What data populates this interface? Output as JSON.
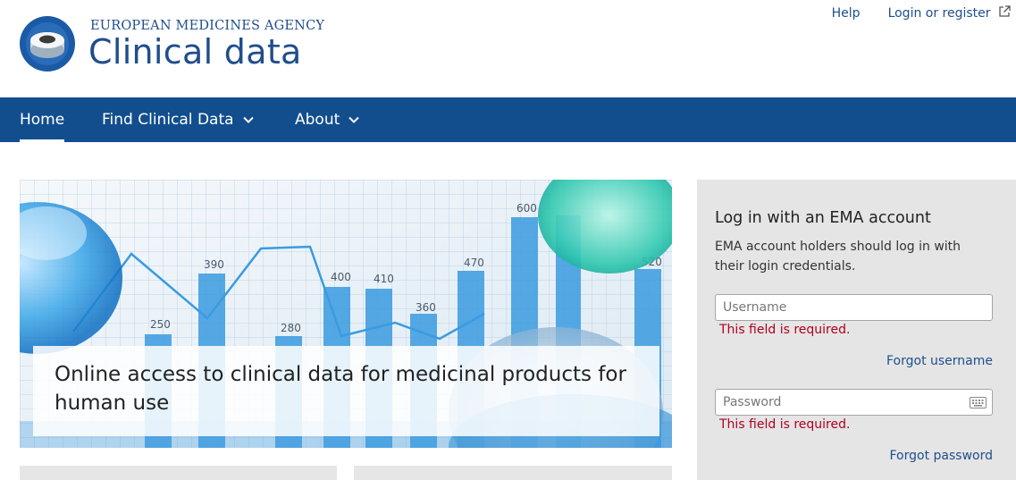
{
  "header": {
    "agency": "EUROPEAN MEDICINES AGENCY",
    "title": "Clinical data",
    "help_label": "Help",
    "login_label": "Login or register"
  },
  "nav": {
    "items": [
      {
        "label": "Home",
        "active": true
      },
      {
        "label": "Find Clinical Data",
        "has_dropdown": true
      },
      {
        "label": "About",
        "has_dropdown": true
      }
    ]
  },
  "hero": {
    "caption": "Online access to clinical data for medicinal products for human use",
    "chart_labels": [
      "390",
      "250",
      "280",
      "400",
      "410",
      "360",
      "470",
      "600",
      "520"
    ]
  },
  "login": {
    "title": "Log in with an EMA account",
    "description": "EMA account holders should log in with their login credentials.",
    "username_placeholder": "Username",
    "username_value": "",
    "username_error": "This field is required.",
    "forgot_username": "Forgot username",
    "password_placeholder": "Password",
    "password_value": "",
    "password_error": "This field is required.",
    "forgot_password": "Forgot password"
  },
  "colors": {
    "brand_blue": "#124e8e",
    "link_blue": "#1f4e8c",
    "error_red": "#b00020",
    "panel_grey": "#e5e5e5"
  }
}
